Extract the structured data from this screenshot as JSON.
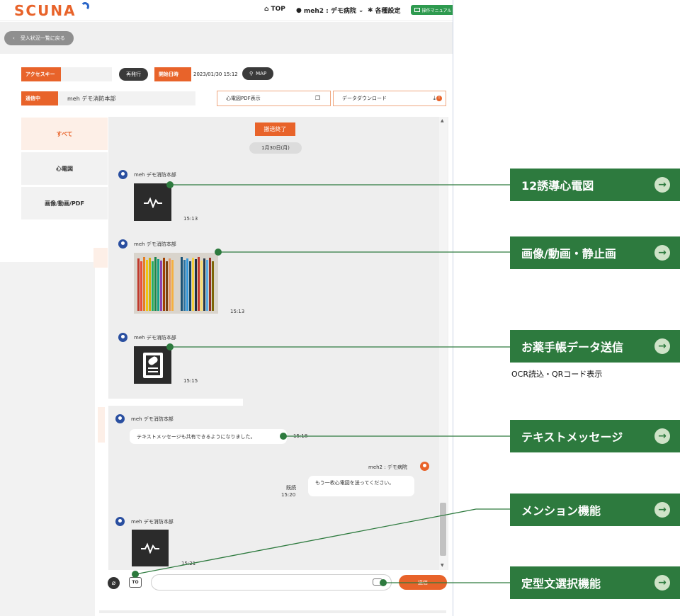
{
  "header": {
    "logo": "SCUNA",
    "nav_top": "TOP",
    "nav_user": "meh2 : デモ病院",
    "nav_settings": "各種設定",
    "nav_manual": "操作マニュアル"
  },
  "topbar": {
    "back_label": "受入状況一覧に戻る"
  },
  "info": {
    "access_key_label": "アクセスキー",
    "reissue_label": "再発行",
    "start_datetime_label": "開始日時",
    "start_datetime_value": "2023/01/30 15:12",
    "map_label": "MAP",
    "status_label": "通信中",
    "sender_name": "meh デモ消防本部",
    "ecg_pdf_label": "心電図PDF表示",
    "data_download_label": "データダウンロード",
    "download_badge": "!"
  },
  "filters": [
    {
      "label": "すべて"
    },
    {
      "label": "心電図"
    },
    {
      "label": "画像/動画/PDF"
    }
  ],
  "chat": {
    "end_button": "搬送終了",
    "date_chip": "1月30日(月)",
    "messages": [
      {
        "sender": "meh デモ消防本部",
        "time": "15:13",
        "kind": "ecg"
      },
      {
        "sender": "meh デモ消防本部",
        "time": "15:13",
        "kind": "photo"
      },
      {
        "sender": "meh デモ消防本部",
        "time": "15:15",
        "kind": "medication-notebook"
      },
      {
        "sender": "meh デモ消防本部",
        "time": "15:18",
        "text": "テキストメッセージも共有できるようになりました。"
      },
      {
        "sender": "meh2 : デモ病院",
        "read": "既読",
        "time": "15:20",
        "text": "もう一枚心電図を送ってください。"
      },
      {
        "sender": "meh デモ消防本部",
        "time": "15:21",
        "kind": "ecg"
      }
    ]
  },
  "compose": {
    "to_label": "TO",
    "input_value": "",
    "input_placeholder": "",
    "send_label": "送信"
  },
  "callouts": [
    {
      "label": "12誘導心電図"
    },
    {
      "label": "画像/動画・静止画"
    },
    {
      "label": "お薬手帳データ送信",
      "sub": "OCR読込・QRコード表示"
    },
    {
      "label": "テキストメッセージ"
    },
    {
      "label": "メンション機能"
    },
    {
      "label": "定型文選択機能"
    }
  ],
  "colors": {
    "accent_orange": "#e8632a",
    "callout_green": "#2d7a3e",
    "avatar_blue": "#2a4fa0"
  }
}
